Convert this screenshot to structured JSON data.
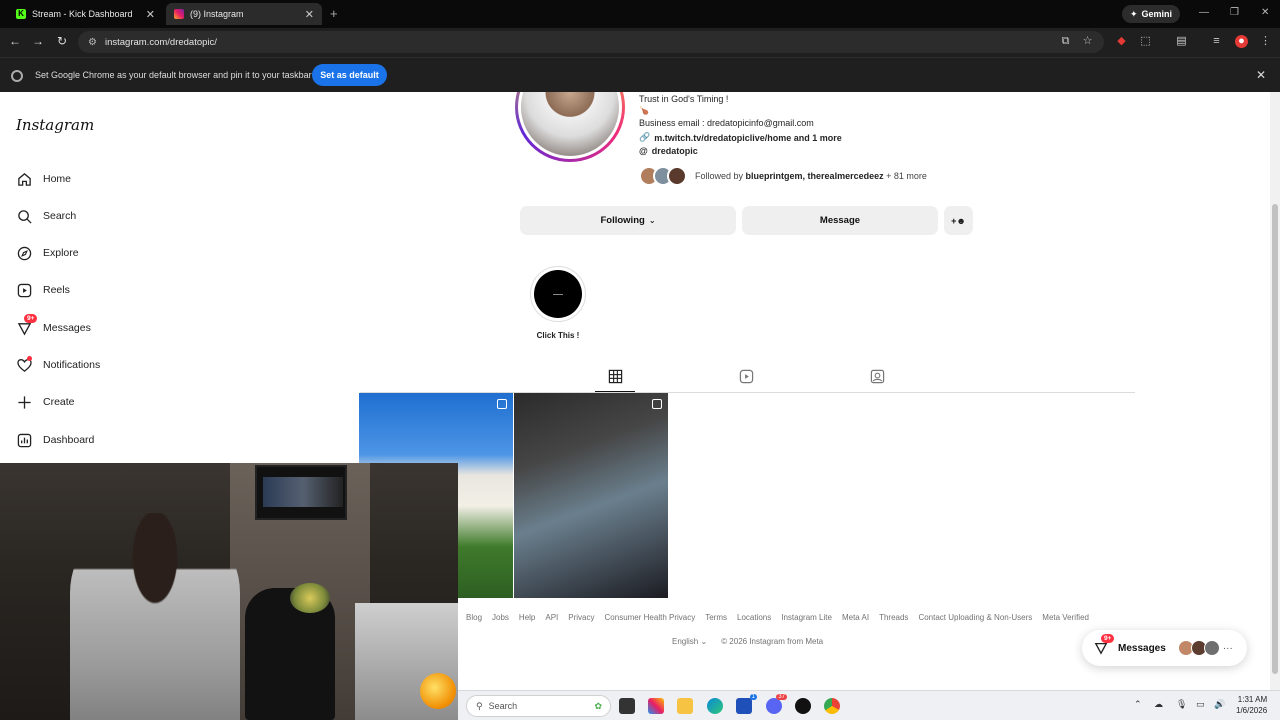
{
  "browser": {
    "tabs": [
      {
        "title": "Stream - Kick Dashboard",
        "favicon": "kick-icon",
        "active": false
      },
      {
        "title": "(9) Instagram",
        "favicon": "instagram-icon",
        "active": true
      }
    ],
    "kick_favicon_letter": "K",
    "gemini_label": "Gemini",
    "url": "instagram.com/dredatopic/",
    "infobar": {
      "message": "Set Google Chrome as your default browser and pin it to your taskbar",
      "button": "Set as default"
    }
  },
  "instagram": {
    "logo": "Instagram",
    "sidebar": {
      "items": [
        {
          "label": "Home",
          "icon": "home-icon"
        },
        {
          "label": "Search",
          "icon": "search-icon"
        },
        {
          "label": "Explore",
          "icon": "compass-icon"
        },
        {
          "label": "Reels",
          "icon": "reels-icon"
        },
        {
          "label": "Messages",
          "icon": "messenger-icon",
          "badge": "9+"
        },
        {
          "label": "Notifications",
          "icon": "heart-icon"
        },
        {
          "label": "Create",
          "icon": "plus-icon"
        },
        {
          "label": "Dashboard",
          "icon": "dashboard-icon"
        }
      ]
    },
    "profile": {
      "bio_line1": "Trust in God's Timing !",
      "bio_line2": "🍗",
      "business_email": "Business email : dredatopicinfo@gmail.com",
      "link": "m.twitch.tv/dredatopiclive/home and 1 more",
      "threads": "dredatopic",
      "followed_by_prefix": "Followed by",
      "followed_by_names": "blueprintgem, therealmercedeez",
      "followed_by_more": "+ 81 more",
      "following_button": "Following",
      "message_button": "Message",
      "highlight_label": "Click This !"
    },
    "footer": {
      "links": [
        "Blog",
        "Jobs",
        "Help",
        "API",
        "Privacy",
        "Consumer Health Privacy",
        "Terms",
        "Locations",
        "Instagram Lite",
        "Meta AI",
        "Threads",
        "Contact Uploading & Non-Users",
        "Meta Verified"
      ],
      "language": "English",
      "copyright": "© 2026 Instagram from Meta"
    },
    "messages_pill": {
      "label": "Messages",
      "badge": "9+",
      "more": "···"
    }
  },
  "taskbar": {
    "search_placeholder": "Search",
    "mail_badge": "1",
    "discord_badge": "37",
    "time": "1:31 AM",
    "date": "1/6/2026"
  },
  "colors": {
    "chrome_dark": "#1f1f1f",
    "accent_blue": "#1a73e8",
    "badge_red": "#ff3040"
  }
}
